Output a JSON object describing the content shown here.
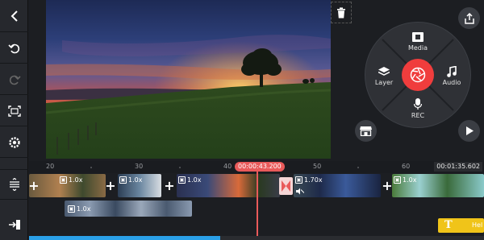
{
  "toolbar": {
    "items": [
      "back-icon",
      "undo-icon",
      "redo-icon",
      "aspect-ratio-icon",
      "settings-icon",
      "layer-order-icon",
      "export-icon"
    ]
  },
  "wheel": {
    "media": "Media",
    "layer": "Layer",
    "audio": "Audio",
    "rec": "REC"
  },
  "timeline": {
    "ticks": [
      "20",
      "30",
      "40",
      "50",
      "60"
    ],
    "playhead_time": "00:00:43.200",
    "total_time": "00:01:35.602",
    "clips": [
      {
        "speed": "1.0x"
      },
      {
        "speed": "1.0x"
      },
      {
        "speed": "1.0x"
      },
      {
        "speed": "1.70x"
      },
      {
        "speed": "1.0x"
      }
    ],
    "layer_clip_speed": "1.0x",
    "text_clip_label": "Hel"
  },
  "progress": {
    "value": 0.42
  },
  "colors": {
    "accent_red": "#f03d3d",
    "text_layer": "#f0c419",
    "progress": "#2aa0e8"
  }
}
